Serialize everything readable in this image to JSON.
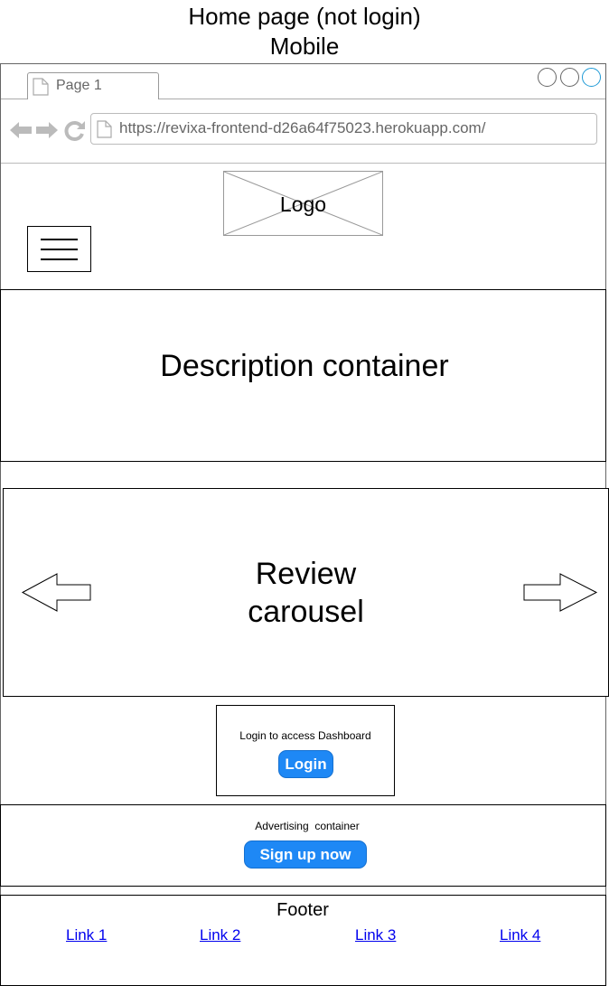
{
  "heading": {
    "title": "Home page (not login)",
    "subtitle": "Mobile"
  },
  "browser": {
    "tab_label": "Page 1",
    "url": "https://revixa-frontend-d26a64f75023.herokuapp.com/",
    "accent": "#1e88f5"
  },
  "header": {
    "logo_label": "Logo"
  },
  "description": {
    "label": "Description container"
  },
  "carousel": {
    "label_line1": "Review",
    "label_line2": "carousel"
  },
  "login_card": {
    "text": "Login to access Dashboard",
    "button_label": "Login"
  },
  "advertising": {
    "text": "Advertising  container",
    "button_label": "Sign up now"
  },
  "footer": {
    "title": "Footer",
    "links": [
      "Link 1",
      "Link 2",
      "Link 3",
      "Link 4"
    ]
  }
}
